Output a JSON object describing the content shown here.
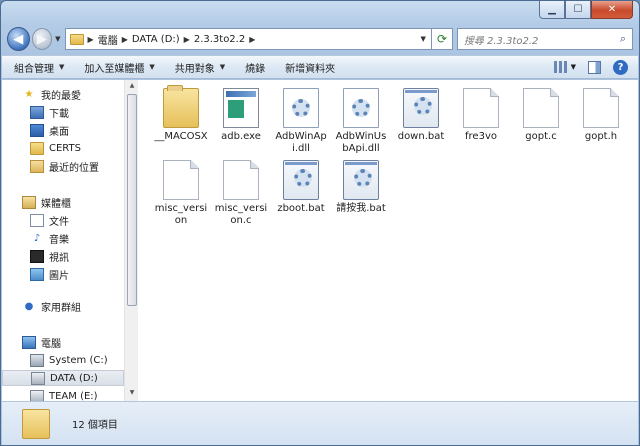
{
  "navigation": {
    "back_label": "◀",
    "forward_label": "▶",
    "breadcrumbs": [
      "電腦",
      "DATA (D:)",
      "2.3.3to2.2"
    ],
    "search_placeholder": "搜尋 2.3.3to2.2"
  },
  "toolbar": {
    "organize": "組合管理",
    "add_to_library": "加入至媒體櫃",
    "share_with": "共用對象",
    "burn": "燒錄",
    "new_folder": "新增資料夾"
  },
  "sidebar": {
    "favorites": {
      "label": "我的最愛",
      "items": [
        "下載",
        "桌面",
        "CERTS",
        "最近的位置"
      ]
    },
    "libraries": {
      "label": "媒體櫃",
      "items": [
        "文件",
        "音樂",
        "視訊",
        "圖片"
      ]
    },
    "homegroup": {
      "label": "家用群組"
    },
    "computer": {
      "label": "電腦",
      "items": [
        "System (C:)",
        "DATA (D:)",
        "TEAM (E:)"
      ]
    }
  },
  "files": [
    {
      "name": "__MACOSX",
      "type": "folder"
    },
    {
      "name": "adb.exe",
      "type": "exe"
    },
    {
      "name": "AdbWinApi.dll",
      "type": "dll"
    },
    {
      "name": "AdbWinUsbApi.dll",
      "type": "dll"
    },
    {
      "name": "down.bat",
      "type": "bat"
    },
    {
      "name": "fre3vo",
      "type": "file"
    },
    {
      "name": "gopt.c",
      "type": "file"
    },
    {
      "name": "gopt.h",
      "type": "file"
    },
    {
      "name": "misc_version",
      "type": "file"
    },
    {
      "name": "misc_version.c",
      "type": "file"
    },
    {
      "name": "zboot.bat",
      "type": "bat"
    },
    {
      "name": "請按我.bat",
      "type": "bat"
    }
  ],
  "status": {
    "item_count": "12 個項目"
  }
}
